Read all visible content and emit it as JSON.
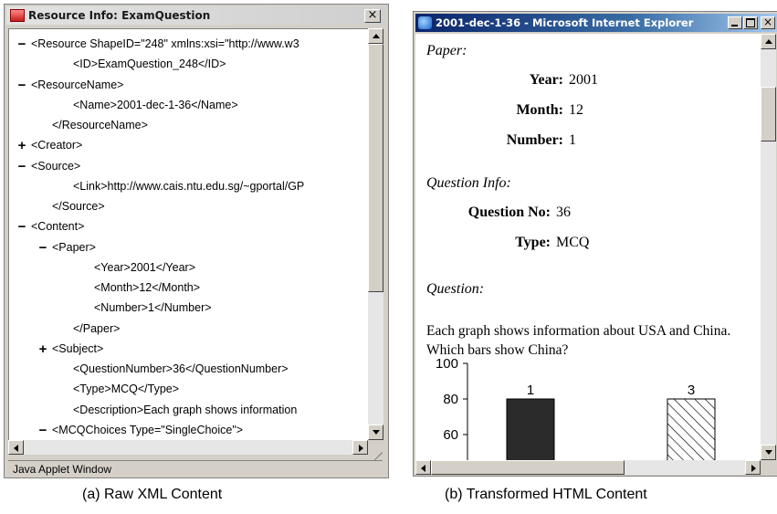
{
  "left_window": {
    "title": "Resource Info: ExamQuestion",
    "status_text": "Java Applet Window",
    "xml_tree": [
      {
        "toggle": "−",
        "text": "<Resource ShapeID=\"248\" xmlns:xsi=\"http://www.w3"
      },
      {
        "toggle": "",
        "text": "<ID>ExamQuestion_248</ID>"
      },
      {
        "toggle": "−",
        "text": "<ResourceName>"
      },
      {
        "toggle": "",
        "text": "<Name>2001-dec-1-36</Name>"
      },
      {
        "toggle": "",
        "text": "</ResourceName>"
      },
      {
        "toggle": "+",
        "text": "<Creator>"
      },
      {
        "toggle": "−",
        "text": "<Source>"
      },
      {
        "toggle": "",
        "text": "<Link>http://www.cais.ntu.edu.sg/~gportal/GP"
      },
      {
        "toggle": "",
        "text": "</Source>"
      },
      {
        "toggle": "−",
        "text": "<Content>"
      },
      {
        "toggle": "−",
        "text": "<Paper>"
      },
      {
        "toggle": "",
        "text": "<Year>2001</Year>"
      },
      {
        "toggle": "",
        "text": "<Month>12</Month>"
      },
      {
        "toggle": "",
        "text": "<Number>1</Number>"
      },
      {
        "toggle": "",
        "text": "</Paper>"
      },
      {
        "toggle": "+",
        "text": "<Subject>"
      },
      {
        "toggle": "",
        "text": "<QuestionNumber>36</QuestionNumber>"
      },
      {
        "toggle": "",
        "text": "<Type>MCQ</Type>"
      },
      {
        "toggle": "",
        "text": "<Description>Each graph shows information"
      },
      {
        "toggle": "−",
        "text": "<MCQChoices Type=\"SingleChoice\">"
      }
    ]
  },
  "right_window": {
    "title": "2001-dec-1-36 - Microsoft Internet Explorer",
    "paper": {
      "heading": "Paper:",
      "year_label": "Year:",
      "year_value": "2001",
      "month_label": "Month:",
      "month_value": "12",
      "number_label": "Number:",
      "number_value": "1"
    },
    "question_info": {
      "heading": "Question Info:",
      "question_no_label": "Question No:",
      "question_no_value": "36",
      "type_label": "Type:",
      "type_value": "MCQ"
    },
    "question": {
      "heading": "Question:",
      "text": "Each graph shows information about USA and China. Which bars show China?"
    }
  },
  "chart_data": {
    "type": "bar",
    "categories": [
      "1",
      "3"
    ],
    "values": [
      80,
      80
    ],
    "fills": [
      "solid",
      "hatched"
    ],
    "yticks": [
      100,
      80,
      60
    ],
    "ylim": [
      55,
      100
    ]
  },
  "captions": {
    "left": "(a) Raw XML Content",
    "right": "(b) Transformed HTML Content"
  }
}
